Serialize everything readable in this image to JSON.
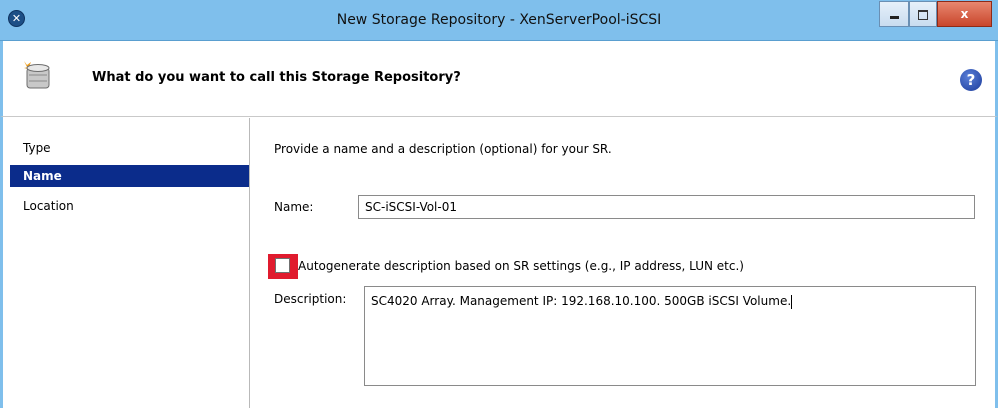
{
  "window": {
    "title": "New Storage Repository - XenServerPool-iSCSI",
    "controls": {
      "minimize": "minimize",
      "maximize": "maximize",
      "close": "x"
    }
  },
  "header": {
    "title": "What do you want to call this Storage Repository?",
    "help_glyph": "?"
  },
  "sidebar": {
    "items": [
      {
        "label": "Type",
        "active": false
      },
      {
        "label": "Name",
        "active": true
      },
      {
        "label": "Location",
        "active": false
      }
    ]
  },
  "main": {
    "intro": "Provide a name and a description (optional) for your SR.",
    "name_label": "Name:",
    "name_value": "SC-iSCSI-Vol-01",
    "autogen_label": "Autogenerate description based on SR settings (e.g., IP address, LUN etc.)",
    "autogen_checked": false,
    "description_label": "Description:",
    "description_value": "SC4020 Array. Management IP: 192.168.10.100. 500GB iSCSI Volume."
  },
  "colors": {
    "titlebar": "#7fbfec",
    "nav_active": "#0b2c8b",
    "checkbox_highlight": "#e01b2e"
  }
}
